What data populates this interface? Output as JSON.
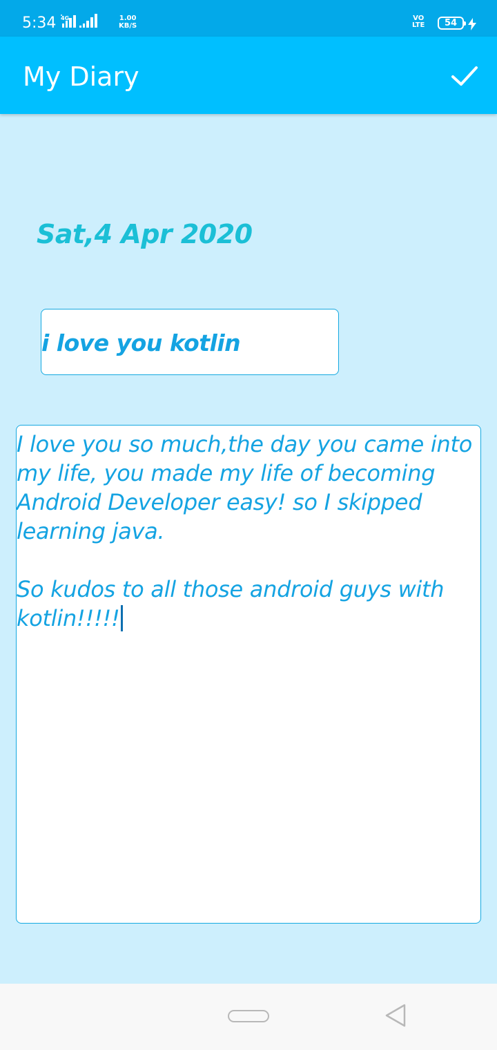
{
  "status_bar": {
    "time": "5:34",
    "network_type": "4G",
    "speed_value": "1.00",
    "speed_unit": "KB/S",
    "volte_top": "VO",
    "volte_bottom": "LTE",
    "battery": "54"
  },
  "app_bar": {
    "title": "My Diary",
    "save_icon": "check-icon"
  },
  "entry": {
    "date": "Sat,4 Apr 2020",
    "title_value": "i love you kotlin",
    "body_value": "I love you so much,the day you came into\nmy life, you made my life of becoming\nAndroid Developer easy! so I skipped\nlearning java.\n\nSo kudos to all those android guys with\nkotlin!!!!!"
  },
  "nav_bar": {
    "home_icon": "home-pill-icon",
    "back_icon": "back-triangle-icon"
  },
  "colors": {
    "status_bar": "#03a9e9",
    "app_bar": "#00bfff",
    "background": "#cdeffd",
    "date_text": "#1bbfd6",
    "entry_text": "#14a3e2"
  }
}
